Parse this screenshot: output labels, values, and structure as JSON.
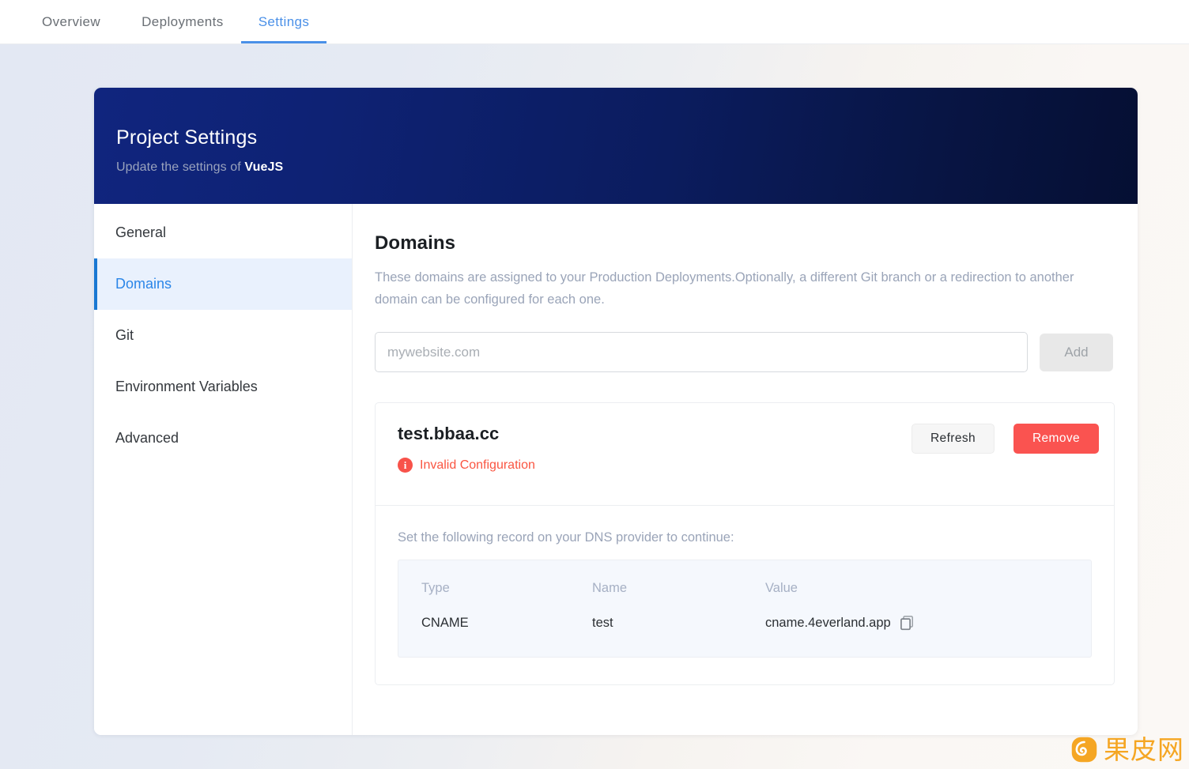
{
  "topnav": {
    "tabs": [
      {
        "label": "Overview",
        "active": false
      },
      {
        "label": "Deployments",
        "active": false
      },
      {
        "label": "Settings",
        "active": true
      }
    ],
    "accent_color": "#4a90e8"
  },
  "header": {
    "title": "Project Settings",
    "subtitle_prefix": "Update the settings of ",
    "project_name": "VueJS",
    "gradient_from": "#10257e",
    "gradient_to": "#050f33"
  },
  "sidebar": {
    "items": [
      {
        "label": "General",
        "active": false
      },
      {
        "label": "Domains",
        "active": true
      },
      {
        "label": "Git",
        "active": false
      },
      {
        "label": "Environment Variables",
        "active": false
      },
      {
        "label": "Advanced",
        "active": false
      }
    ],
    "active_color": "#2b86e8",
    "active_bg": "#e9f1fd"
  },
  "main": {
    "title": "Domains",
    "description": "These domains are assigned to your Production Deployments.Optionally, a different Git branch or a redirection to another domain can be configured for each one.",
    "add_form": {
      "input_value": "",
      "input_placeholder": "mywebsite.com",
      "add_label": "Add",
      "add_disabled": true
    },
    "domain_card": {
      "domain": "test.bbaa.cc",
      "status_text": "Invalid Configuration",
      "status_icon": "info-circle-icon",
      "status_color": "#fa5541",
      "refresh_label": "Refresh",
      "remove_label": "Remove",
      "remove_color": "#fa5350",
      "dns_hint": "Set the following record on your DNS provider to continue:",
      "dns_table": {
        "columns": [
          "Type",
          "Name",
          "Value"
        ],
        "rows": [
          {
            "type": "CNAME",
            "name": "test",
            "value": "cname.4everland.app",
            "copy_icon": "copy-icon"
          }
        ]
      }
    }
  },
  "watermark": {
    "text": "果皮网",
    "color": "#f5a623",
    "logo_icon": "guopi-logo-icon"
  }
}
